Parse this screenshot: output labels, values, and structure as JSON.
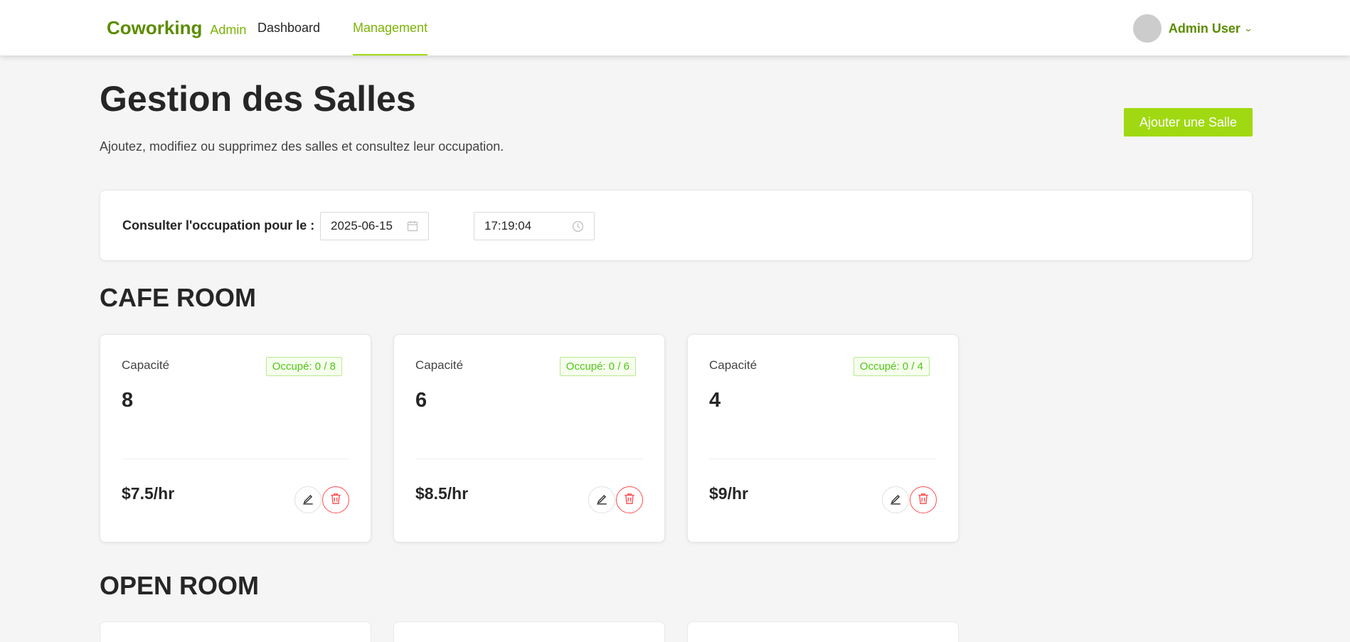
{
  "header": {
    "brand_main": "Coworking",
    "brand_sub": "Admin",
    "nav": [
      {
        "label": "Dashboard",
        "active": false
      },
      {
        "label": "Management",
        "active": true
      }
    ],
    "user_name": "Admin User",
    "user_menu_icon": "chevron-down-icon"
  },
  "page": {
    "title": "Gestion des Salles",
    "description": "Ajoutez, modifiez ou supprimez des salles et consultez leur occupation.",
    "add_button": "Ajouter une Salle"
  },
  "filter": {
    "label": "Consulter l'occupation pour le :",
    "date": "2025-06-15",
    "date_icon": "calendar-icon",
    "time": "17:19:04",
    "time_icon": "clock-icon"
  },
  "sections": [
    {
      "title": "CAFE ROOM",
      "rooms": [
        {
          "capacity_label": "Capacité",
          "capacity": "8",
          "occupancy": "Occupé: 0 / 8",
          "price": "$7.5/hr"
        },
        {
          "capacity_label": "Capacité",
          "capacity": "6",
          "occupancy": "Occupé: 0 / 6",
          "price": "$8.5/hr"
        },
        {
          "capacity_label": "Capacité",
          "capacity": "4",
          "occupancy": "Occupé: 0 / 4",
          "price": "$9/hr"
        }
      ]
    },
    {
      "title": "OPEN ROOM",
      "rooms": []
    }
  ],
  "colors": {
    "brand": "#5b8c00",
    "accent": "#a0d911",
    "danger": "#ff4d4f",
    "success": "#52c41a"
  }
}
